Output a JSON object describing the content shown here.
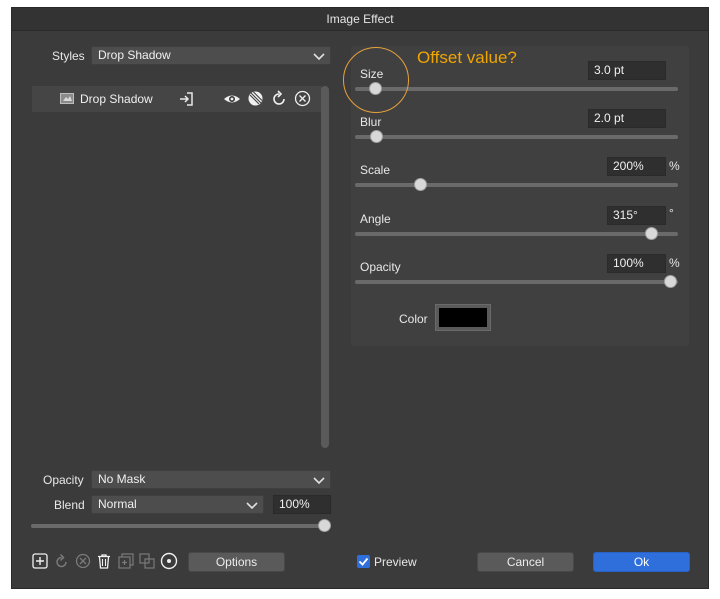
{
  "window": {
    "title": "Image Effect"
  },
  "styles": {
    "label": "Styles",
    "value": "Drop Shadow"
  },
  "effects": [
    {
      "name": "Drop Shadow"
    }
  ],
  "annotation": {
    "text": "Offset value?"
  },
  "params": {
    "size": {
      "label": "Size",
      "value": "3.0 pt",
      "level": 0.07
    },
    "blur": {
      "label": "Blur",
      "value": "2.0 pt",
      "level": 0.07
    },
    "scale": {
      "label": "Scale",
      "value": "200%",
      "unit": "%",
      "level": 0.21
    },
    "angle": {
      "label": "Angle",
      "value": "315°",
      "unit": "°",
      "level": 0.93
    },
    "opacity": {
      "label": "Opacity",
      "value": "100%",
      "unit": "%",
      "level": 1.0
    },
    "color": {
      "label": "Color",
      "swatch": "#000000"
    }
  },
  "bottom": {
    "opacity_label": "Opacity",
    "opacity_value": "No Mask",
    "blend_label": "Blend",
    "blend_value": "Normal",
    "blend_percent": "100%",
    "blend_level": 1.0
  },
  "preview": {
    "label": "Preview",
    "checked": true
  },
  "buttons": {
    "options": "Options",
    "cancel": "Cancel",
    "ok": "Ok"
  },
  "colors": {
    "accent": "#2f6fdc",
    "annotation": "#f0a500"
  }
}
